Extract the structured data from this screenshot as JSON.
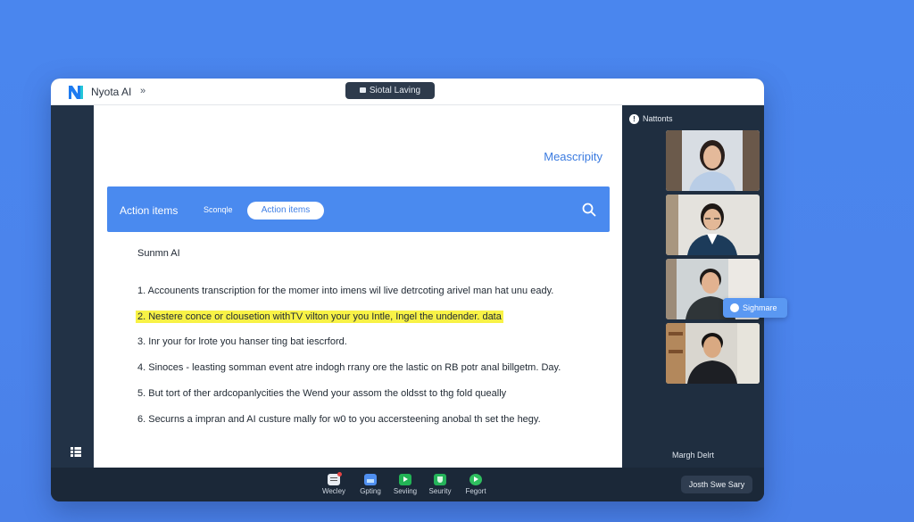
{
  "app": {
    "title": "Nyota AI",
    "chevron": "»",
    "center_pill": "Siotal Laving"
  },
  "document": {
    "heading": "Meascripity",
    "toolbar": {
      "title": "Action items",
      "tab_plain": "Sconqle",
      "tab_active": "Action items",
      "search_icon": "search-icon"
    },
    "summary_title": "Sunmn AI",
    "items": [
      {
        "text": "1.  Accounents transcription for the momer into imens wil live detrcoting arivel man hat unu eady.",
        "highlight": false
      },
      {
        "text": "2.  Nestere conce or clousetion withTV vilton your you Intle, Ingel the undender. data",
        "highlight": true
      },
      {
        "text": "3.  Inr your for lrote you hanser ting bat iescrford.",
        "highlight": false
      },
      {
        "text": "4.  Sinoces - leasting somman event atre indogh rrany ore the lastic on RB potr anal billgetm. Day.",
        "highlight": false
      },
      {
        "text": "5.  But tort of ther ardcopanlycities the Wend your assom the oldsst to thg fold queally",
        "highlight": false
      },
      {
        "text": "6.  Securns a impran and AI custure mally for w0 to you accersteening anobal th set the hegy.",
        "highlight": false
      }
    ],
    "highlight_color": "#f8f246"
  },
  "participants": {
    "header": "Nattonts",
    "footer": "Margh Delrt",
    "chip": "Sighmare",
    "tiles": [
      "participant-1",
      "participant-2",
      "participant-3",
      "participant-4"
    ]
  },
  "bottombar": {
    "items": [
      {
        "label": "Wecley",
        "icon": "notes-icon",
        "color": "#e8ecf2"
      },
      {
        "label": "Gpting",
        "icon": "image-icon",
        "color": "#4f8ff0"
      },
      {
        "label": "Seviing",
        "icon": "play-icon",
        "color": "#22b455"
      },
      {
        "label": "Seurity",
        "icon": "shield-icon",
        "color": "#25b35a"
      },
      {
        "label": "Fegort",
        "icon": "record-icon",
        "color": "#2fbf5f"
      }
    ],
    "user_pill": "Josth Swe Sary"
  },
  "colors": {
    "accent": "#4a8aef",
    "background": "#4a86ee",
    "panel": "#1f2e40"
  }
}
